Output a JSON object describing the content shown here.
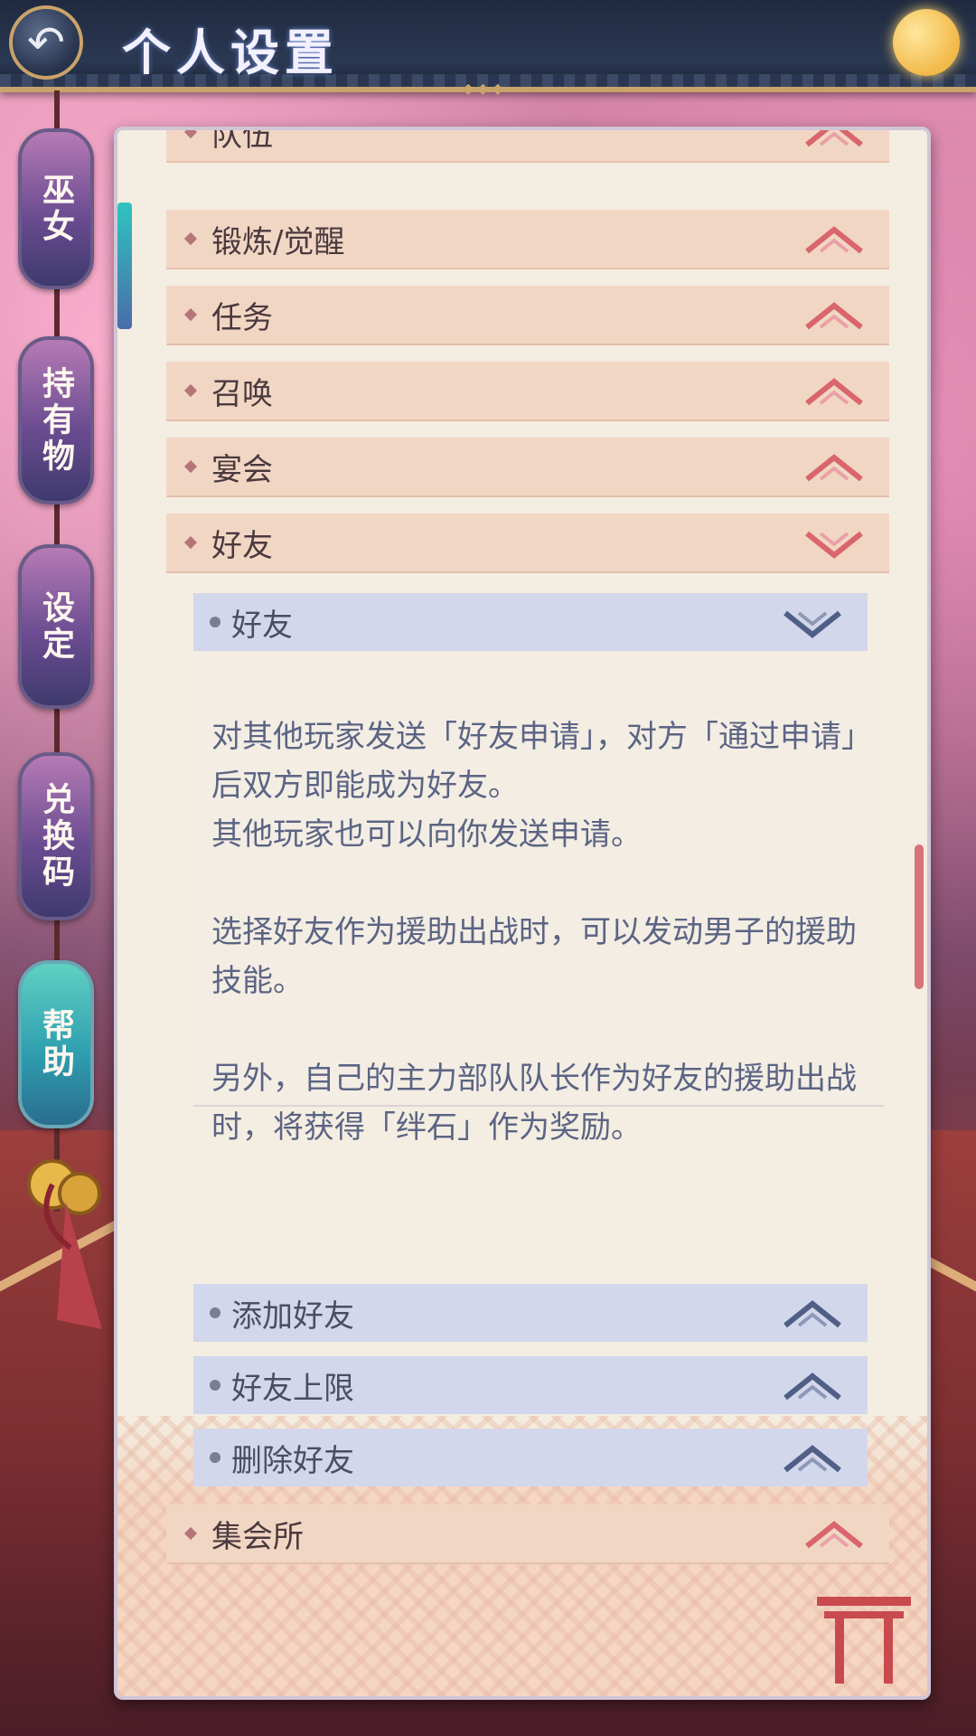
{
  "header": {
    "back_icon": "back-arrow-icon",
    "title": "个人设置"
  },
  "sidebar": {
    "tabs": [
      {
        "label": "巫女",
        "active": false
      },
      {
        "label": "持有物",
        "active": false
      },
      {
        "label": "设定",
        "active": false
      },
      {
        "label": "兑换码",
        "active": false
      },
      {
        "label": "帮助",
        "active": true
      }
    ]
  },
  "help": {
    "categories": [
      {
        "label": "队伍",
        "state": "collapsed"
      },
      {
        "label": "锻炼/觉醒",
        "state": "collapsed"
      },
      {
        "label": "任务",
        "state": "collapsed"
      },
      {
        "label": "召唤",
        "state": "collapsed"
      },
      {
        "label": "宴会",
        "state": "collapsed"
      },
      {
        "label": "好友",
        "state": "expanded"
      },
      {
        "label": "集会所",
        "state": "collapsed"
      }
    ],
    "friend_sub": [
      {
        "label": "好友",
        "state": "expanded"
      },
      {
        "label": "添加好友",
        "state": "collapsed"
      },
      {
        "label": "好友上限",
        "state": "collapsed"
      },
      {
        "label": "删除好友",
        "state": "collapsed"
      }
    ],
    "friend_description": "对其他玩家发送「好友申请」，对方「通过申请」后双方即能成为好友。\n其他玩家也可以向你发送申请。\n\n选择好友作为援助出战时，可以发动男子的援助技能。\n\n另外，自己的主力部队队长作为好友的援助出战时，将获得「绊石」作为奖励。"
  },
  "colors": {
    "category_bg": "#f2d6c4",
    "sub_bg": "#d3d7ec",
    "chevron_red": "#d9656e",
    "chevron_blue": "#4f5f86",
    "active_tab": "#2f9fb0"
  }
}
